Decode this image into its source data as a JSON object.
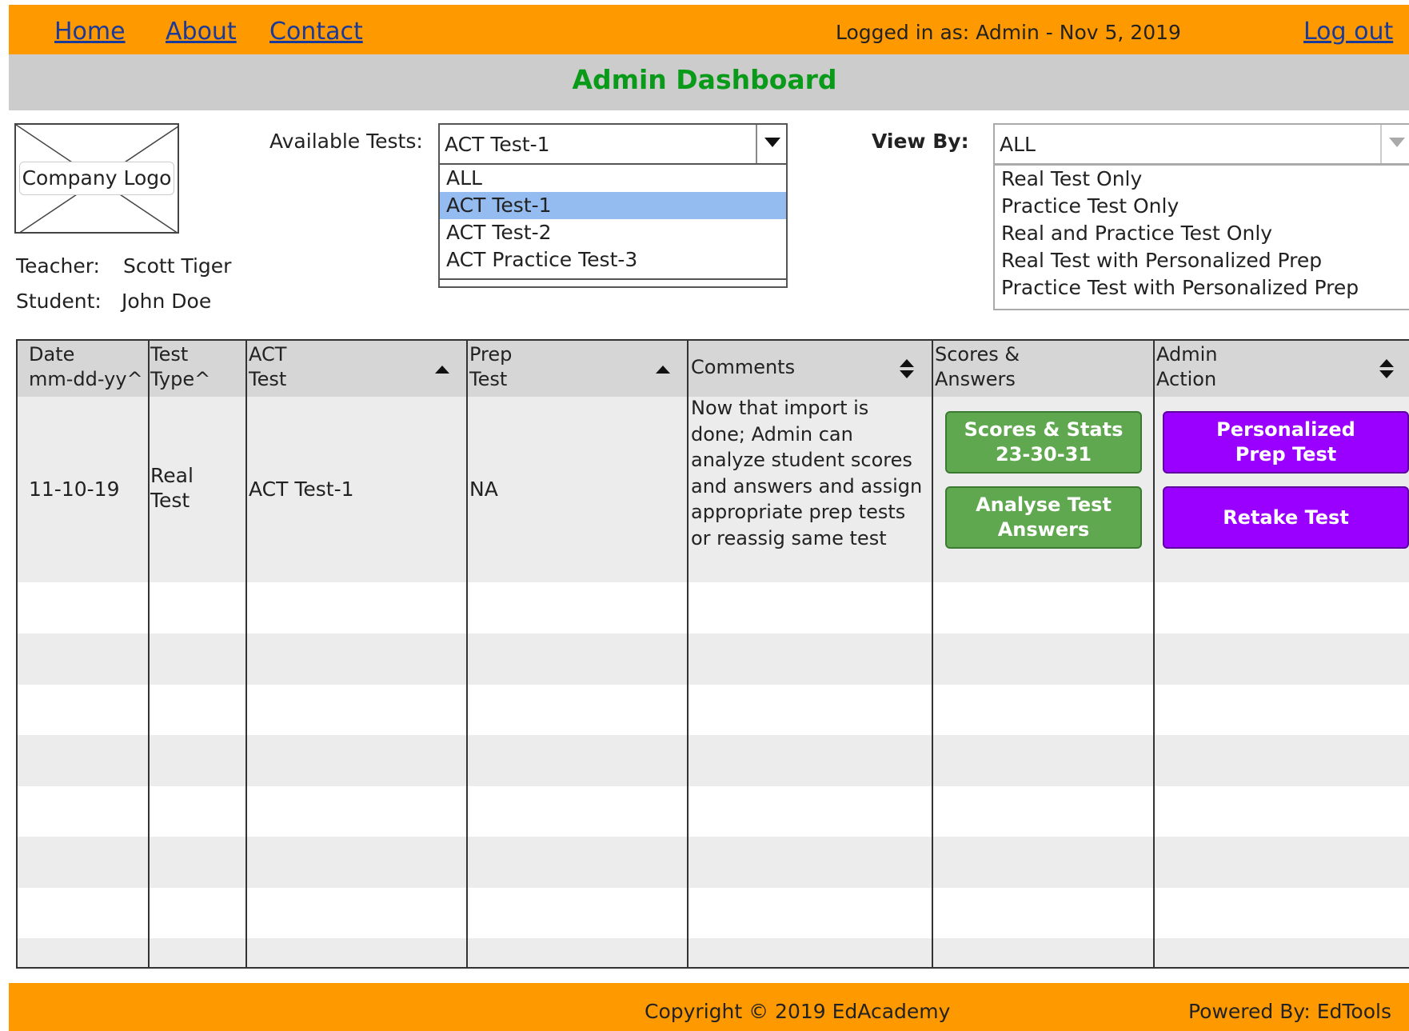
{
  "nav": {
    "home": "Home",
    "about": "About",
    "contact": "Contact",
    "logout": "Log out"
  },
  "header": {
    "login_info": "Logged in as: Admin - Nov 5, 2019",
    "title": "Admin Dashboard"
  },
  "logo": {
    "label": "Company Logo"
  },
  "info": {
    "teacher_label": "Teacher:",
    "teacher_name": "Scott Tiger",
    "student_label": "Student:",
    "student_name": "John Doe"
  },
  "tests": {
    "label": "Available Tests:",
    "selected": "ACT Test-1",
    "options": [
      "ALL",
      "ACT Test-1",
      "ACT Test-2",
      "ACT Practice Test-3"
    ]
  },
  "view_by": {
    "label": "View By:",
    "selected": "ALL",
    "options": [
      "Real Test Only",
      "Practice Test Only",
      "Real and Practice Test Only",
      "Real Test with Personalized Prep",
      "Practice Test with Personalized Prep"
    ]
  },
  "table": {
    "headers": {
      "date": [
        "Date",
        "mm-dd-yy^"
      ],
      "type": [
        "Test",
        "Type^"
      ],
      "act": [
        "ACT",
        "Test"
      ],
      "prep": [
        "Prep",
        "Test"
      ],
      "comments": [
        "Comments"
      ],
      "scores": [
        "Scores &",
        "Answers"
      ],
      "admin": [
        "Admin",
        "Action"
      ]
    },
    "row": {
      "date": "11-10-19",
      "type": [
        "Real",
        "Test"
      ],
      "act": "ACT Test-1",
      "prep": "NA",
      "comments": [
        "Now that import is",
        "done; Admin can",
        "analyze student scores",
        "and answers and assign",
        "appropriate prep tests",
        "or reassig same test"
      ],
      "scores_btn": [
        "Scores & Stats",
        "23-30-31"
      ],
      "analyse_btn": [
        "Analyse Test",
        "Answers"
      ],
      "prep_btn": [
        "Personalized",
        "Prep Test"
      ],
      "retake_btn": "Retake Test"
    }
  },
  "footer": {
    "copyright": "Copyright © 2019 EdAcademy",
    "powered": "Powered By: EdTools"
  },
  "colors": {
    "bar": "#ff9900",
    "title": "#0a9a1a",
    "green_button": "#60a850",
    "purple_button": "#9900ff",
    "selected_option": "#94bcf0"
  }
}
